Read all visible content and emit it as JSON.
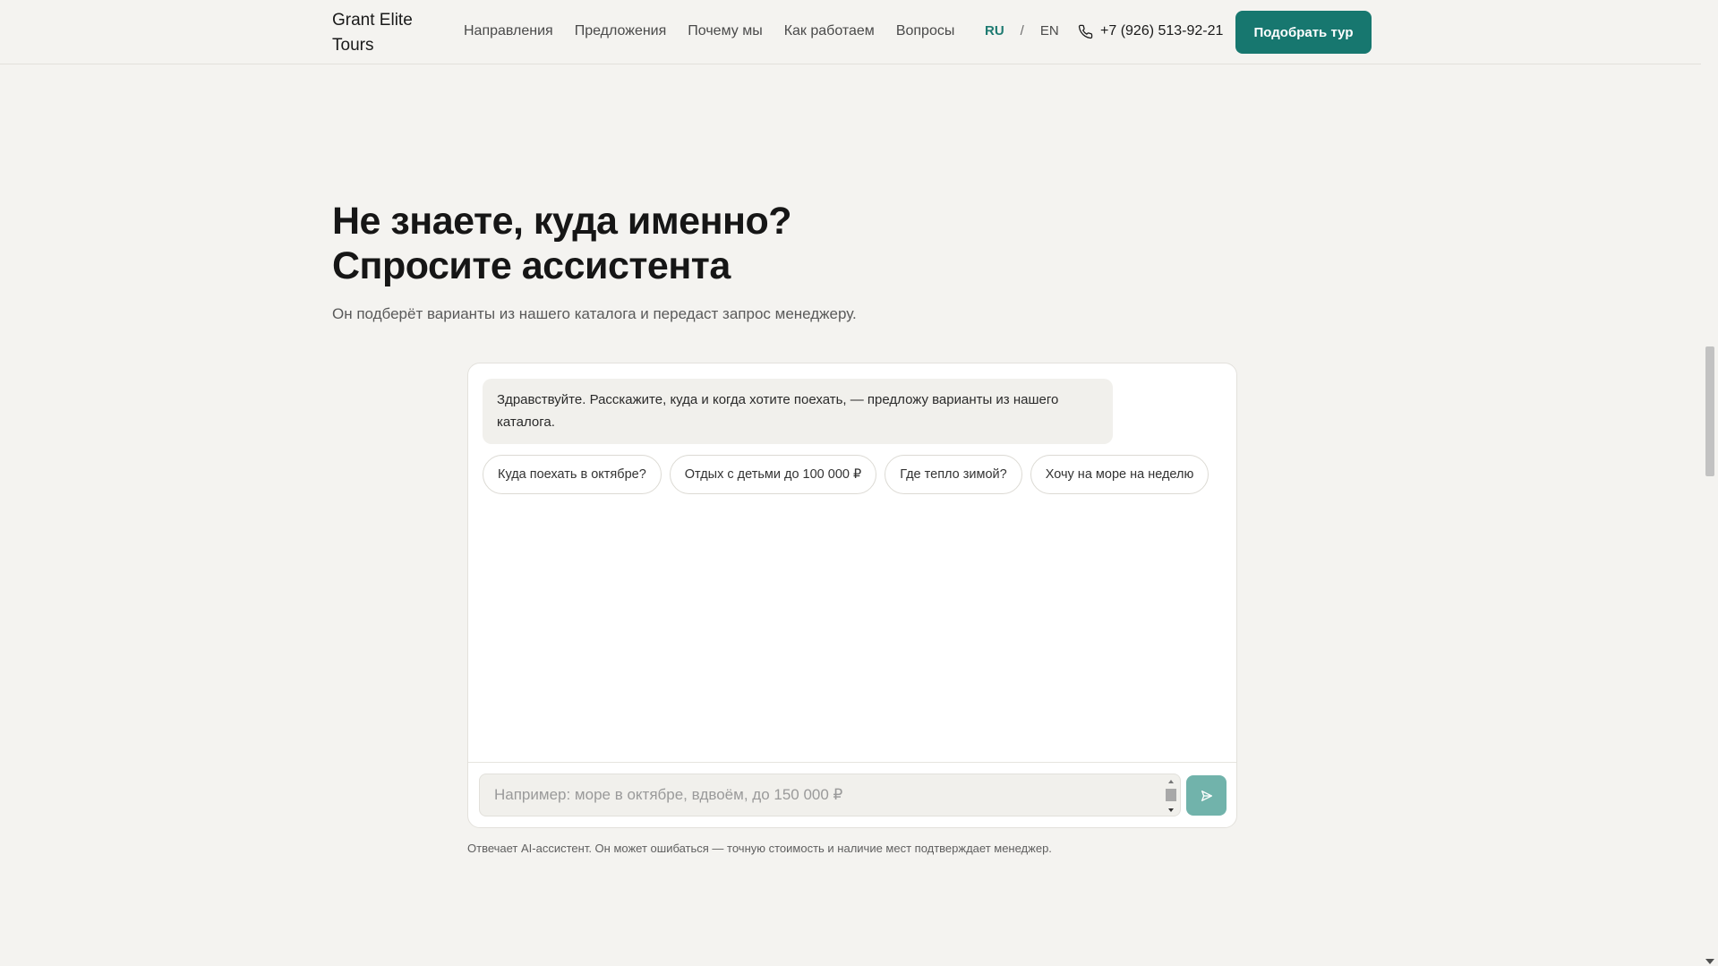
{
  "header": {
    "logo": "Grant Elite Tours",
    "nav": [
      "Направления",
      "Предложения",
      "Почему мы",
      "Как работаем",
      "Вопросы"
    ],
    "lang": {
      "ru": "RU",
      "separator": "/",
      "en": "EN",
      "active": "RU"
    },
    "phone": "+7 (926) 513-92-21",
    "cta_label": "Подобрать тур"
  },
  "hero": {
    "title_line1": "Не знаете, куда именно?",
    "title_line2": "Спросите ассистента",
    "subtitle": "Он подберёт варианты из нашего каталога и передаст запрос менеджеру."
  },
  "chat": {
    "greeting": "Здравствуйте. Расскажите, куда и когда хотите поехать, — предложу варианты из нашего каталога.",
    "suggestions": [
      "Куда поехать в октябре?",
      "Отдых с детьми до 100 000 ₽",
      "Где тепло зимой?",
      "Хочу на море на неделю"
    ],
    "input_placeholder": "Например: море в октябре, вдвоём, до 150 000 ₽",
    "disclaimer": "Отвечает AI-ассистент. Он может ошибаться — точную стоимость и наличие мест подтверждает менеджер."
  },
  "colors": {
    "accent": "#17776f",
    "send_button": "#71b3ab",
    "background": "#f4f3f0"
  },
  "icons": {
    "phone": "phone-icon",
    "send": "send-icon"
  }
}
